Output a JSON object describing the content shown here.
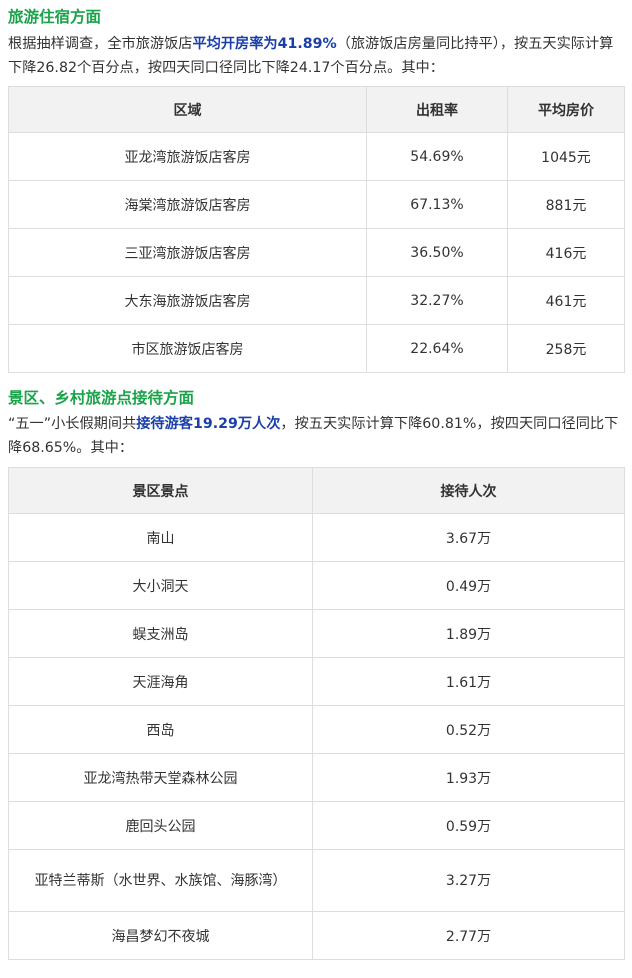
{
  "hotel": {
    "heading": "旅游住宿方面",
    "p_pre": "根据抽样调查，全市旅游饭店",
    "p_hl": "平均开房率为41.89%",
    "p_post": "（旅游饭店房量同比持平），按五天实际计算下降26.82个百分点，按四天同口径同比下降24.17个百分点。其中：",
    "columns": [
      "区域",
      "出租率",
      "平均房价"
    ],
    "rows": [
      {
        "region": "亚龙湾旅游饭店客房",
        "rate": "54.69%",
        "price": "1045元"
      },
      {
        "region": "海棠湾旅游饭店客房",
        "rate": "67.13%",
        "price": "881元"
      },
      {
        "region": "三亚湾旅游饭店客房",
        "rate": "36.50%",
        "price": "416元"
      },
      {
        "region": "大东海旅游饭店客房",
        "rate": "32.27%",
        "price": "461元"
      },
      {
        "region": "市区旅游饭店客房",
        "rate": "22.64%",
        "price": "258元"
      }
    ]
  },
  "scenic": {
    "heading": "景区、乡村旅游点接待方面",
    "p_pre": "“五一”小长假期间共",
    "p_hl": "接待游客19.29万人次",
    "p_post": "，按五天实际计算下降60.81%，按四天同口径同比下降68.65%。其中：",
    "columns": [
      "景区景点",
      "接待人次"
    ],
    "rows": [
      {
        "name": "南山",
        "visits": "3.67万"
      },
      {
        "name": "大小洞天",
        "visits": "0.49万"
      },
      {
        "name": "蜈支洲岛",
        "visits": "1.89万"
      },
      {
        "name": "天涯海角",
        "visits": "1.61万"
      },
      {
        "name": "西岛",
        "visits": "0.52万"
      },
      {
        "name": "亚龙湾热带天堂森林公园",
        "visits": "1.93万"
      },
      {
        "name": "鹿回头公园",
        "visits": "0.59万"
      },
      {
        "name": "亚特兰蒂斯（水世界、水族馆、海豚湾）",
        "visits": "3.27万"
      },
      {
        "name": "海昌梦幻不夜城",
        "visits": "2.77万"
      }
    ]
  },
  "colors": {
    "heading": "#1aa34a",
    "highlight": "#1a3fa8",
    "border": "#dddddd",
    "header_bg": "#f2f2f2"
  }
}
